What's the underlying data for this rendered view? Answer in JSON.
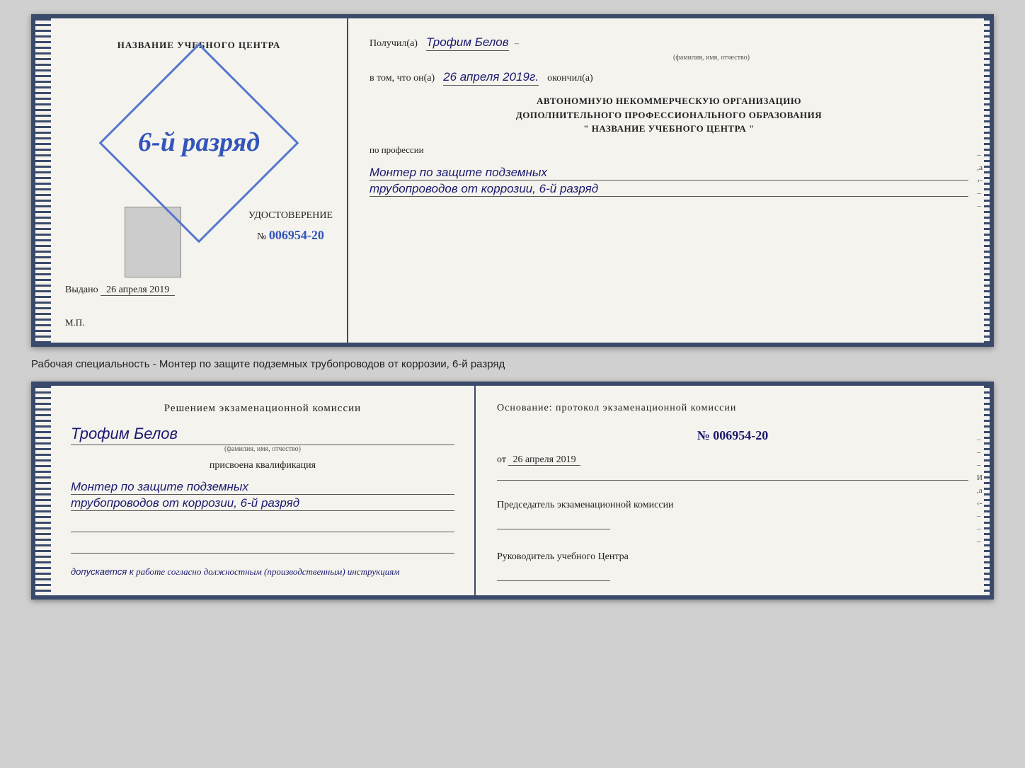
{
  "top_doc": {
    "left": {
      "title": "НАЗВАНИЕ УЧЕБНОГО ЦЕНТРА",
      "stamp_text": "6-й разряд",
      "cert_label": "УДОСТОВЕРЕНИЕ",
      "cert_number_prefix": "№",
      "cert_number": "006954-20",
      "photo_placeholder": "",
      "issued_prefix": "Выдано",
      "issued_date": "26 апреля 2019",
      "mp_label": "М.П."
    },
    "right": {
      "received_label": "Получил(а)",
      "recipient_name": "Трофим Белов",
      "recipient_name_subtitle": "(фамилия, имя, отчество)",
      "name_dash": "–",
      "in_that_label": "в том, что он(а)",
      "completion_date": "26 апреля 2019г.",
      "completion_suffix": "окончил(а)",
      "org_line1": "АВТОНОМНУЮ НЕКОММЕРЧЕСКУЮ ОРГАНИЗАЦИЮ",
      "org_line2": "ДОПОЛНИТЕЛЬНОГО ПРОФЕССИОНАЛЬНОГО ОБРАЗОВАНИЯ",
      "org_line3": "\" НАЗВАНИЕ УЧЕБНОГО ЦЕНТРА \"",
      "profession_label": "по профессии",
      "profession_line1": "Монтер по защите подземных",
      "profession_line2": "трубопроводов от коррозии, 6-й разряд"
    }
  },
  "middle": {
    "text": "Рабочая специальность - Монтер по защите подземных трубопроводов от коррозии, 6-й разряд"
  },
  "bottom_doc": {
    "left": {
      "decision_label": "Решением экзаменационной комиссии",
      "name": "Трофим Белов",
      "name_subtitle": "(фамилия, имя, отчество)",
      "assigned_label": "присвоена квалификация",
      "qual_line1": "Монтер по защите подземных",
      "qual_line2": "трубопроводов от коррозии, 6-й разряд",
      "admitted_prefix": "допускается к",
      "admitted_text": "работе согласно должностным (производственным) инструкциям"
    },
    "right": {
      "basis_label": "Основание: протокол экзаменационной комиссии",
      "number_prefix": "№",
      "number": "006954-20",
      "date_prefix": "от",
      "date": "26 апреля 2019",
      "chairman_label": "Председатель экзаменационной комиссии",
      "director_label": "Руководитель учебного Центра"
    }
  }
}
